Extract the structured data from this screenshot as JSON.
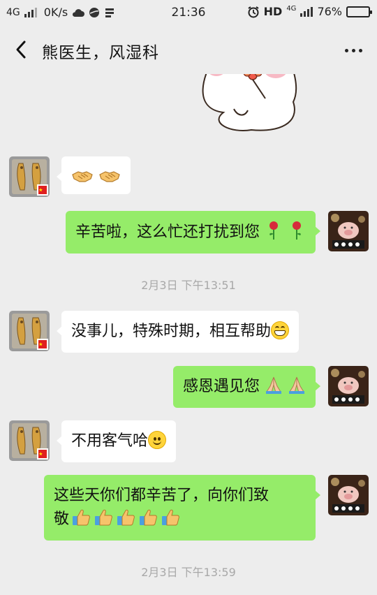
{
  "status_bar": {
    "network": "4G",
    "speed": "0K/s",
    "time": "21:36",
    "hd": "HD",
    "net_small": "4G",
    "battery_text": "76%",
    "battery_level": 0.76
  },
  "header": {
    "title": "熊医生，风湿科",
    "back_icon": "chevron-left-icon",
    "more_icon": "more-dots-icon"
  },
  "messages": [
    {
      "side": "in",
      "text": "",
      "emoji": [
        "handshake",
        "handshake"
      ]
    },
    {
      "side": "out",
      "text": "辛苦啦，这么忙还打扰到您",
      "emoji": [
        "rose",
        "rose"
      ]
    },
    {
      "timestamp": "2月3日 下午13:51"
    },
    {
      "side": "in",
      "text": "没事儿，特殊时期，相互帮助",
      "emoji": [
        "grin"
      ]
    },
    {
      "side": "out",
      "text": "感恩遇见您",
      "emoji": [
        "folded-hands",
        "folded-hands"
      ]
    },
    {
      "side": "in",
      "text": "不用客气哈",
      "emoji": [
        "smile"
      ]
    },
    {
      "side": "out",
      "text_line1": "这些天你们都辛苦了，向你们致",
      "text_line2": "敬",
      "emoji": [
        "thumbs-up",
        "thumbs-up",
        "thumbs-up",
        "thumbs-up",
        "thumbs-up"
      ]
    },
    {
      "timestamp": "2月3日 下午13:59"
    }
  ],
  "colors": {
    "background": "#ededed",
    "outgoing_bubble": "#95ec69",
    "incoming_bubble": "#ffffff",
    "timestamp": "#a8a8a8"
  }
}
